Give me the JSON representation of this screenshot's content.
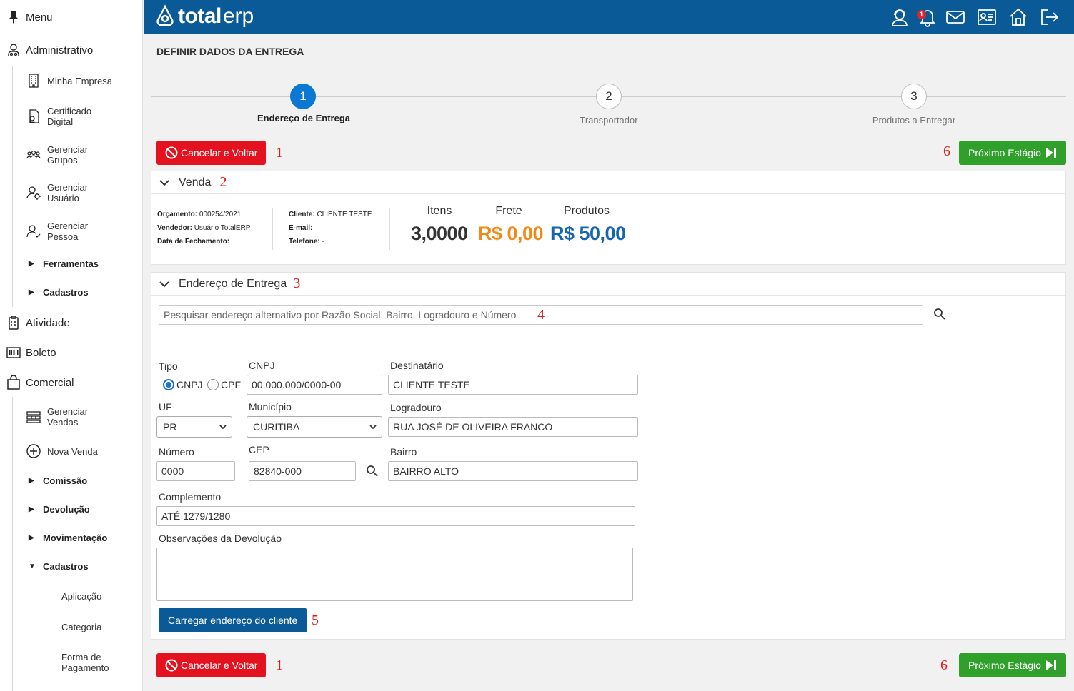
{
  "sidebar": {
    "menu": "Menu",
    "administrativo": "Administrativo",
    "admin_items": [
      "Minha Empresa",
      "Certificado Digital",
      "Gerenciar Grupos",
      "Gerenciar Usuário",
      "Gerenciar Pessoa"
    ],
    "ferramentas": "Ferramentas",
    "cadastros_admin": "Cadastros",
    "atividade": "Atividade",
    "boleto": "Boleto",
    "comercial": "Comercial",
    "comercial_items": [
      "Gerenciar Vendas",
      "Nova Venda"
    ],
    "comissao": "Comissão",
    "devolucao": "Devolução",
    "movimentacao": "Movimentação",
    "cadastros_comercial": "Cadastros",
    "cadastros_items": [
      "Aplicação",
      "Categoria",
      "Forma de Pagamento"
    ]
  },
  "topbar": {
    "logo_bold": "total",
    "logo_light": "erp",
    "notification_count": "1",
    "icons": [
      "support-icon",
      "bell-icon",
      "mail-icon",
      "id-card-icon",
      "home-icon",
      "logout-icon"
    ]
  },
  "page": {
    "title": "DEFINIR DADOS DA ENTREGA"
  },
  "steps": [
    {
      "num": "1",
      "label": "Endereço de Entrega",
      "active": true
    },
    {
      "num": "2",
      "label": "Transportador",
      "active": false
    },
    {
      "num": "3",
      "label": "Produtos a Entregar",
      "active": false
    }
  ],
  "actions": {
    "cancel": "Cancelar e Voltar",
    "next": "Próximo Estágio"
  },
  "markers": {
    "m1": "1",
    "m2": "2",
    "m3": "3",
    "m4": "4",
    "m5": "5",
    "m6": "6"
  },
  "venda": {
    "header": "Venda",
    "orcamento_label": "Orçamento:",
    "orcamento": "000254/2021",
    "vendedor_label": "Vendedor:",
    "vendedor": "Usuário TotalERP",
    "data_label": "Data de Fechamento:",
    "cliente_label": "Cliente:",
    "cliente": "CLIENTE TESTE",
    "email_label": "E-mail:",
    "telefone_label": "Telefone:",
    "telefone": "-",
    "itens_label": "Itens",
    "itens": "3,0000",
    "frete_label": "Frete",
    "frete": "R$ 0,00",
    "produtos_label": "Produtos",
    "produtos": "R$ 50,00"
  },
  "endereco": {
    "header": "Endereço de Entrega",
    "search_placeholder": "Pesquisar endereço alternativo por Razão Social, Bairro, Logradouro e Número",
    "tipo_label": "Tipo",
    "radio_cnpj": "CNPJ",
    "radio_cpf": "CPF",
    "cnpj_label": "CNPJ",
    "cnpj_value": "00.000.000/0000-00",
    "destinatario_label": "Destinatário",
    "destinatario_value": "CLIENTE TESTE",
    "uf_label": "UF",
    "uf_value": "PR",
    "municipio_label": "Município",
    "municipio_value": "CURITIBA",
    "logradouro_label": "Logradouro",
    "logradouro_value": "RUA JOSÉ DE OLIVEIRA FRANCO",
    "numero_label": "Número",
    "numero_value": "0000",
    "cep_label": "CEP",
    "cep_value": "82840-000",
    "bairro_label": "Bairro",
    "bairro_value": "BAIRRO ALTO",
    "complemento_label": "Complemento",
    "complemento_value": "ATÉ 1279/1280",
    "observacoes_label": "Observações da Devolução",
    "load_button": "Carregar endereço do cliente"
  },
  "colors": {
    "topbar": "#0a5a98",
    "cancel": "#e3121e",
    "next": "#2fa12b",
    "frete": "#f08a18",
    "produtos": "#1565b0"
  }
}
